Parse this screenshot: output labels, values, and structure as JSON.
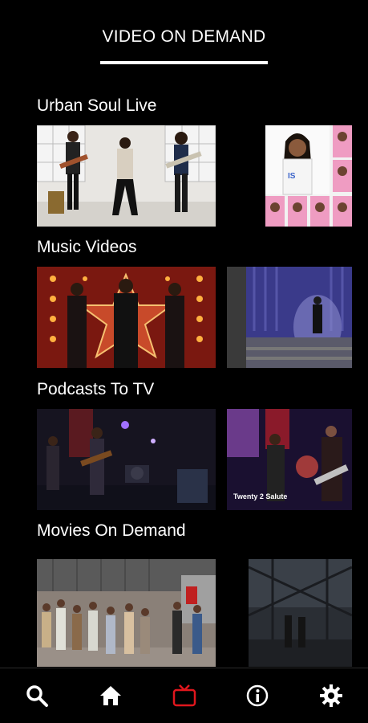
{
  "header": {
    "title": "VIDEO ON DEMAND"
  },
  "sections": [
    {
      "title": "Urban Soul Live",
      "thumbnails": [
        "band-in-white-studio",
        "vocal-group-grid"
      ]
    },
    {
      "title": "Music Videos",
      "thumbnails": [
        "trio-on-stage-with-lights",
        "singer-in-spotlight"
      ]
    },
    {
      "title": "Podcasts To TV",
      "thumbnails": [
        "band-on-dark-stage",
        "band-live-performance"
      ],
      "tile_caption": "Twenty 2 Salute"
    },
    {
      "title": "Movies On Demand",
      "thumbnails": [
        "street-crowd-scene",
        "dark-bridge-scene"
      ]
    }
  ],
  "tabs": [
    {
      "name": "search",
      "icon": "search-icon",
      "active": false
    },
    {
      "name": "home",
      "icon": "home-icon",
      "active": false
    },
    {
      "name": "tv",
      "icon": "tv-icon",
      "active": true
    },
    {
      "name": "info",
      "icon": "info-icon",
      "active": false
    },
    {
      "name": "settings",
      "icon": "gear-icon",
      "active": false
    }
  ],
  "colors": {
    "background": "#000000",
    "text": "#ffffff",
    "active_tab": "#e0161d",
    "inactive_tab": "#ffffff"
  }
}
